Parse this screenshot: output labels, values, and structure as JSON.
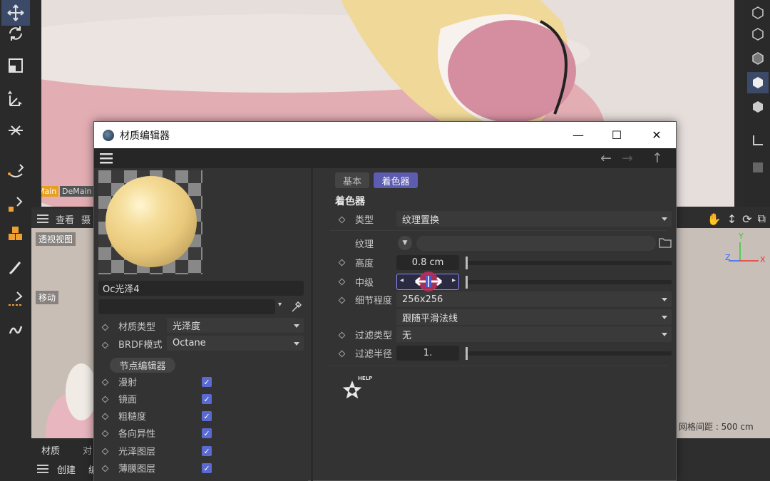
{
  "viewport": {
    "tag_main": "Main",
    "tag_demain": "DeMain",
    "menu_view": "查看",
    "menu_cut": "摄",
    "perspective_label": "透视视图",
    "move_label": "移动",
    "grid_spacing": "网格间距 : 500 cm",
    "axis_x": "X",
    "axis_y": "Y",
    "axis_z": "Z"
  },
  "bottom_panel": {
    "tab_material": "材质",
    "tab_object": "对",
    "menu_create": "创建",
    "menu_edit": "编"
  },
  "window": {
    "title": "材质编辑器",
    "minimize": "—",
    "maximize": "☐",
    "close": "✕"
  },
  "nav": {
    "back": "←",
    "forward": "→",
    "up": "↑"
  },
  "material": {
    "name": "Oc光泽4",
    "search_placeholder": "",
    "material_type_label": "材质类型",
    "material_type_value": "光泽度",
    "brdf_label": "BRDF模式",
    "brdf_value": "Octane",
    "node_editor_button": "节点编辑器",
    "channels": [
      {
        "label": "漫射",
        "checked": true
      },
      {
        "label": "镜面",
        "checked": true
      },
      {
        "label": "粗糙度",
        "checked": true
      },
      {
        "label": "各向异性",
        "checked": true
      },
      {
        "label": "光泽图层",
        "checked": true
      },
      {
        "label": "薄膜图层",
        "checked": true
      }
    ]
  },
  "shader": {
    "tab_basic": "基本",
    "tab_shader": "着色器",
    "section_title": "着色器",
    "type_label": "类型",
    "type_value": "纹理置换",
    "texture_label": "纹理",
    "height_label": "高度",
    "height_value": "0.8 cm",
    "mid_label": "中级",
    "mid_value": "",
    "detail_label": "细节程度",
    "detail_value": "256x256",
    "normal_value": "跟随平滑法线",
    "filter_type_label": "过滤类型",
    "filter_type_value": "无",
    "filter_radius_label": "过滤半径",
    "filter_radius_value": "1.",
    "help_label": "HELP"
  },
  "colors": {
    "accent": "#5a6ad0",
    "active_tab": "#5c5cb0",
    "main_tag": "#e8a020",
    "window_title_bg": "#ffffff",
    "panel_bg": "#333333"
  }
}
